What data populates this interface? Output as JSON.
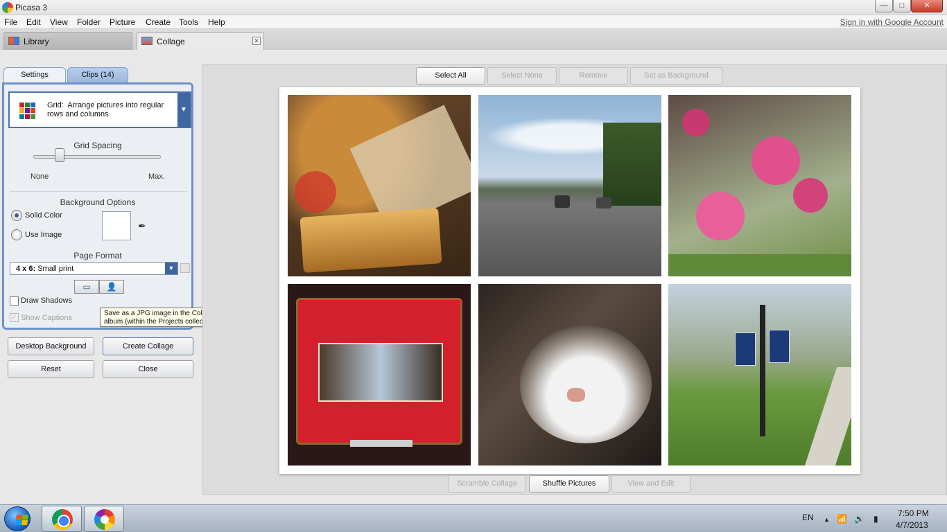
{
  "window": {
    "title": "Picasa 3",
    "controls": {
      "minimize": "—",
      "maximize": "□",
      "close": "✕"
    }
  },
  "menu": {
    "items": [
      "File",
      "Edit",
      "View",
      "Folder",
      "Picture",
      "Create",
      "Tools",
      "Help"
    ],
    "sign_in": "Sign in with Google Account"
  },
  "tabs": {
    "library": "Library",
    "collage": "Collage",
    "close_glyph": "✕"
  },
  "panel": {
    "tabs": {
      "settings": "Settings",
      "clips": "Clips (14)"
    },
    "layout": {
      "name": "Grid:",
      "description": "Arrange pictures into regular rows and columns",
      "arrow": "▼"
    },
    "grid_spacing": {
      "title": "Grid Spacing",
      "min_label": "None",
      "max_label": "Max.",
      "value_fraction": 0.17
    },
    "background": {
      "title": "Background Options",
      "solid_color": "Solid Color",
      "use_image": "Use Image",
      "selected": "solid_color",
      "swatch_color": "#ffffff",
      "eyedropper_glyph": "✒"
    },
    "page_format": {
      "title": "Page Format",
      "size": "4 x 6:",
      "size_desc": "Small print",
      "arrow": "▼",
      "landscape_glyph": "▭",
      "portrait_glyph": "👤"
    },
    "draw_shadows": {
      "label": "Draw Shadows",
      "checked": false
    },
    "show_captions": {
      "label": "Show Captions",
      "checked": true,
      "disabled": true,
      "check_glyph": "✓"
    }
  },
  "tooltip": {
    "line1": "Save as a JPG image in the Collages",
    "line2": "album (within the Projects collection)."
  },
  "buttons": {
    "desktop_background": "Desktop Background",
    "create_collage": "Create Collage",
    "reset": "Reset",
    "close": "Close"
  },
  "canvas_toolbar": {
    "select_all": "Select All",
    "select_none": "Select None",
    "remove": "Remove",
    "set_as_background": "Set as Background"
  },
  "bottom_toolbar": {
    "scramble_collage": "Scramble Collage",
    "shuffle_pictures": "Shuffle Pictures",
    "view_and_edit": "View and Edit"
  },
  "taskbar": {
    "language": "EN",
    "time": "7:50 PM",
    "date": "4/7/2013",
    "tray_up_glyph": "▲",
    "signal_glyph": "📶",
    "speaker_glyph": "🔊",
    "battery_glyph": "▮"
  },
  "colors": {
    "panel_border": "#6c92c8",
    "accent_blue": "#3f66a0"
  }
}
